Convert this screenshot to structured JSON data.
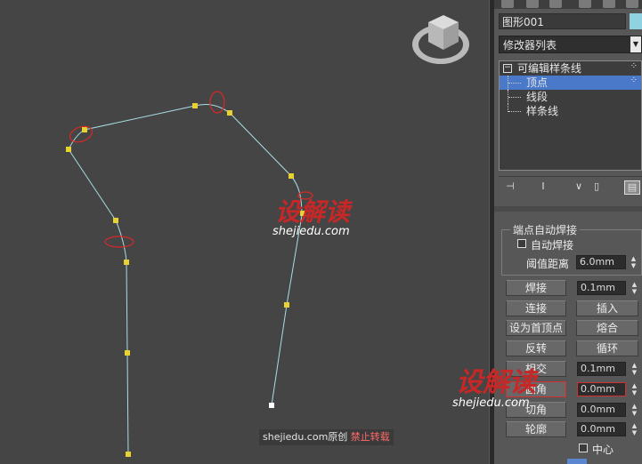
{
  "viewport": {
    "bg": "#454545",
    "spline_color": "#a9dde6",
    "vertex_color": "#e8d232",
    "marker_color": "#d92828",
    "viewcube_icon": "viewcube-icon"
  },
  "watermark_center": {
    "brand": "设解读",
    "site": "shejiedu.com"
  },
  "watermark_right": {
    "brand": "设解读",
    "site": "shejiedu.com"
  },
  "footer_notice": {
    "site": "shejiedu.com",
    "text": "原创",
    "warning": "禁止转载"
  },
  "panel": {
    "object_name": "图形001",
    "object_color": "#8fd3e0",
    "modifier_list": "修改器列表",
    "stack": [
      {
        "label": "可编辑样条线"
      },
      {
        "label": "顶点"
      },
      {
        "label": "线段"
      },
      {
        "label": "样条线"
      }
    ],
    "stack_icons": [
      "pin-stack-icon",
      "show-end-result-icon",
      "make-unique-icon",
      "remove-modifier-icon",
      "configure-sets-icon"
    ],
    "weld_group": {
      "title": "端点自动焊接",
      "auto_weld": "自动焊接",
      "threshold_label": "阈值距离",
      "threshold_value": "6.0mm"
    },
    "buttons": {
      "weld": "焊接",
      "weld_value": "0.1mm",
      "connect": "连接",
      "insert": "插入",
      "make_first": "设为首顶点",
      "fuse": "熔合",
      "reverse": "反转",
      "cycle": "循环",
      "crossinsert": "相交",
      "crossinsert_value": "0.1mm",
      "fillet": "圆角",
      "fillet_value": "0.0mm",
      "chamfer": "切角",
      "chamfer_value": "0.0mm",
      "outline": "轮廓",
      "outline_value": "0.0mm",
      "center": "中心"
    }
  }
}
